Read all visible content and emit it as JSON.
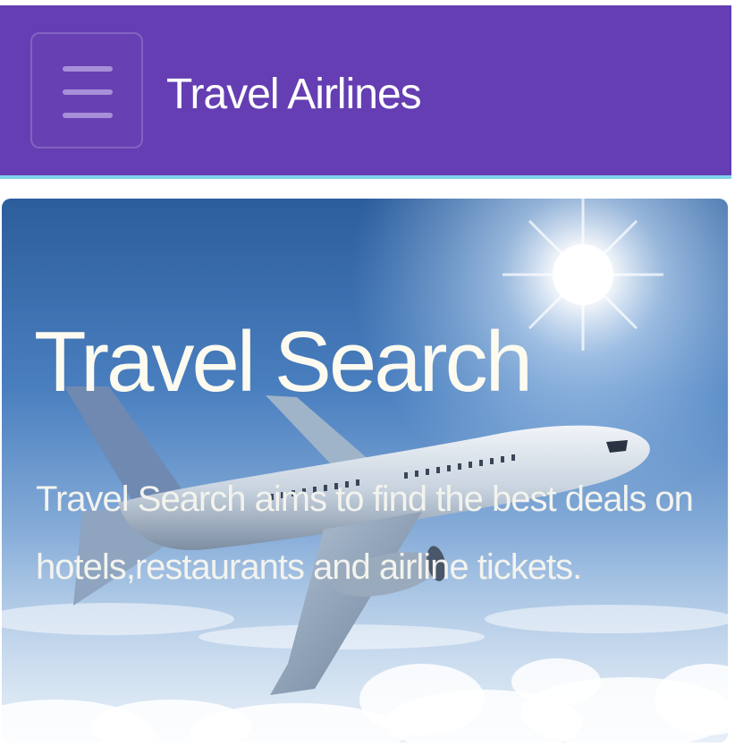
{
  "navbar": {
    "brand": "Travel Airlines",
    "menu_icon": "hamburger-menu-icon",
    "background_color": "#643eb2",
    "accent_border_color": "#7fd3ea"
  },
  "hero": {
    "title": "Travel Search",
    "description": "Travel Search aims to find the best deals on hotels,restaurants and airline tickets.",
    "background_image": "airplane-sky-image"
  }
}
